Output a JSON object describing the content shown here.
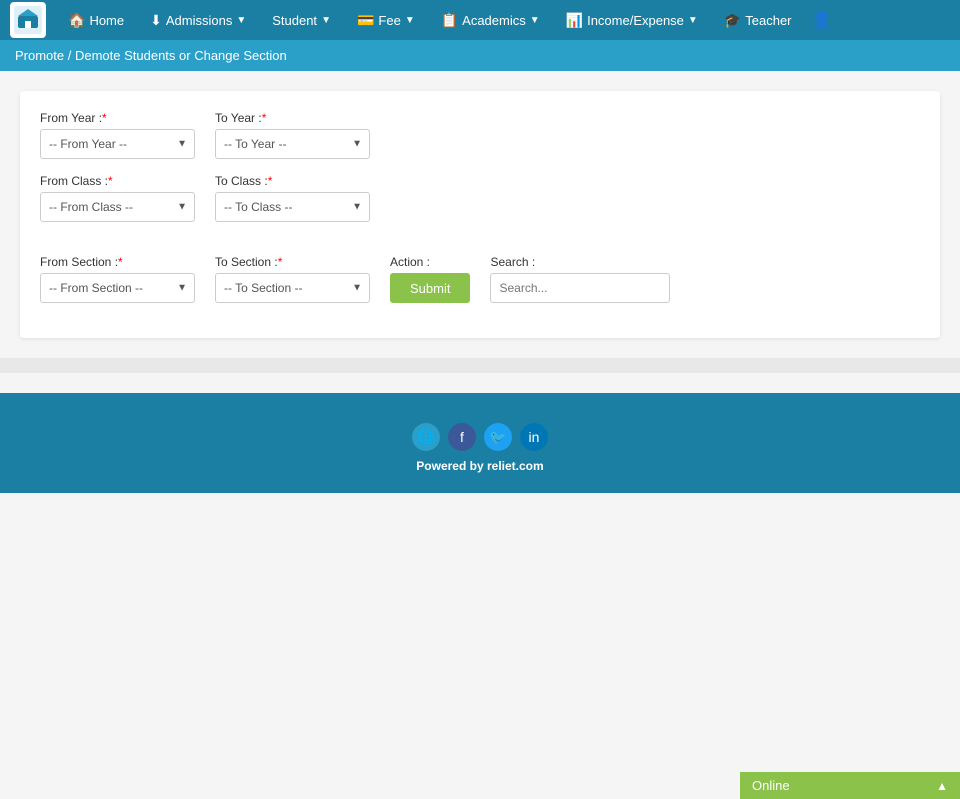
{
  "brand": {
    "alt": "School Logo"
  },
  "navbar": {
    "items": [
      {
        "label": "Home",
        "icon": "🏠",
        "hasDropdown": false
      },
      {
        "label": "Admissions",
        "icon": "⬇",
        "hasDropdown": true
      },
      {
        "label": "Student",
        "icon": "",
        "hasDropdown": true
      },
      {
        "label": "Fee",
        "icon": "💳",
        "hasDropdown": true
      },
      {
        "label": "Academics",
        "icon": "📋",
        "hasDropdown": true
      },
      {
        "label": "Income/Expense",
        "icon": "📊",
        "hasDropdown": true
      },
      {
        "label": "Teacher",
        "icon": "🎓",
        "hasDropdown": false
      }
    ],
    "user_icon": "👤"
  },
  "breadcrumb": {
    "text": "Promote / Demote Students or Change Section"
  },
  "form": {
    "from_year_label": "From Year :",
    "from_year_required": "*",
    "from_year_placeholder": "-- From Year --",
    "to_year_label": "To Year :",
    "to_year_required": "*",
    "to_year_placeholder": "-- To Year --",
    "from_class_label": "From Class :",
    "from_class_required": "*",
    "from_class_placeholder": "-- From Class --",
    "to_class_label": "To Class :",
    "to_class_required": "*",
    "to_class_placeholder": "-- To Class --",
    "from_section_label": "From Section :",
    "from_section_required": "*",
    "from_section_placeholder": "-- From Section --",
    "to_section_label": "To Section :",
    "to_section_required": "*",
    "to_section_placeholder": "-- To Section --",
    "action_label": "Action :",
    "submit_label": "Submit",
    "search_label": "Search :",
    "search_placeholder": "Search..."
  },
  "footer": {
    "powered_by": "Powered by ",
    "powered_site": "reliet.com"
  },
  "online_bar": {
    "label": "Online",
    "chevron": "▲"
  }
}
